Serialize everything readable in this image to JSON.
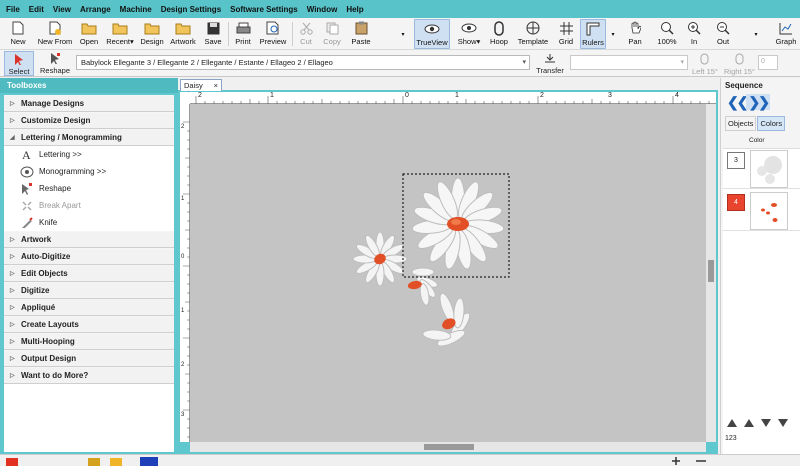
{
  "menu": [
    "File",
    "Edit",
    "View",
    "Arrange",
    "Machine",
    "Design Settings",
    "Software Settings",
    "Window",
    "Help"
  ],
  "toolbar": {
    "new": "New",
    "new_from": "New From",
    "open": "Open",
    "recent": "Recent",
    "design": "Design",
    "artwork": "Artwork",
    "save": "Save",
    "print": "Print",
    "preview": "Preview",
    "cut": "Cut",
    "copy": "Copy",
    "paste": "Paste",
    "trueview": "TrueView",
    "show": "Show",
    "hoop": "Hoop",
    "template": "Template",
    "grid": "Grid",
    "rulers": "Rulers",
    "pan": "Pan",
    "zoom100": "100%",
    "in": "In",
    "out": "Out",
    "graph": "Graph"
  },
  "toolbar2": {
    "select": "Select",
    "reshape": "Reshape",
    "path": "Babylock Ellegante 3 / Ellegante 2 / Ellegante / Estante / Ellageo 2 / Ellageo",
    "transfer": "Transfer",
    "left": "Left 15°",
    "right": "Right 15°",
    "box_value": "0"
  },
  "toolboxes": {
    "title": "Toolboxes",
    "sections": [
      {
        "label": "Manage Designs",
        "open": false
      },
      {
        "label": "Customize Design",
        "open": false
      },
      {
        "label": "Lettering / Monogramming",
        "open": true
      },
      {
        "label": "Artwork",
        "open": false
      },
      {
        "label": "Auto-Digitize",
        "open": false
      },
      {
        "label": "Edit Objects",
        "open": false
      },
      {
        "label": "Digitize",
        "open": false
      },
      {
        "label": "Appliqué",
        "open": false
      },
      {
        "label": "Create Layouts",
        "open": false
      },
      {
        "label": "Multi-Hooping",
        "open": false
      },
      {
        "label": "Output Design",
        "open": false
      },
      {
        "label": "Want to do More?",
        "open": false
      }
    ],
    "lettering_items": [
      {
        "label": "Lettering >>",
        "icon": "lettering-icon",
        "disabled": false
      },
      {
        "label": "Monogramming >>",
        "icon": "monogram-icon",
        "disabled": false
      },
      {
        "label": "Reshape",
        "icon": "reshape-icon",
        "disabled": false
      },
      {
        "label": "Break Apart",
        "icon": "break-apart-icon",
        "disabled": true
      },
      {
        "label": "Knife",
        "icon": "knife-icon",
        "disabled": false
      }
    ]
  },
  "document": {
    "tab_title": "Daisy Jkt",
    "close": "×",
    "hruler_labels": [
      "2",
      "1",
      "0",
      "1",
      "2",
      "3",
      "4"
    ],
    "vruler_labels": [
      "2",
      "1",
      "0",
      "1",
      "2",
      "3"
    ]
  },
  "sequence": {
    "title": "Sequence",
    "tabs": [
      "Objects",
      "Colors"
    ],
    "active_tab": "Colors",
    "color_label": "Color",
    "rows": [
      {
        "num": "3",
        "color": "#ffffff"
      },
      {
        "num": "4",
        "color": "#e8442e"
      }
    ],
    "bottom_label": "123"
  },
  "colors": {
    "menubar": "#58c3c9",
    "panel": "#5ec8ce",
    "canvas": "#c4c4c4",
    "accent_red": "#e8442e"
  }
}
